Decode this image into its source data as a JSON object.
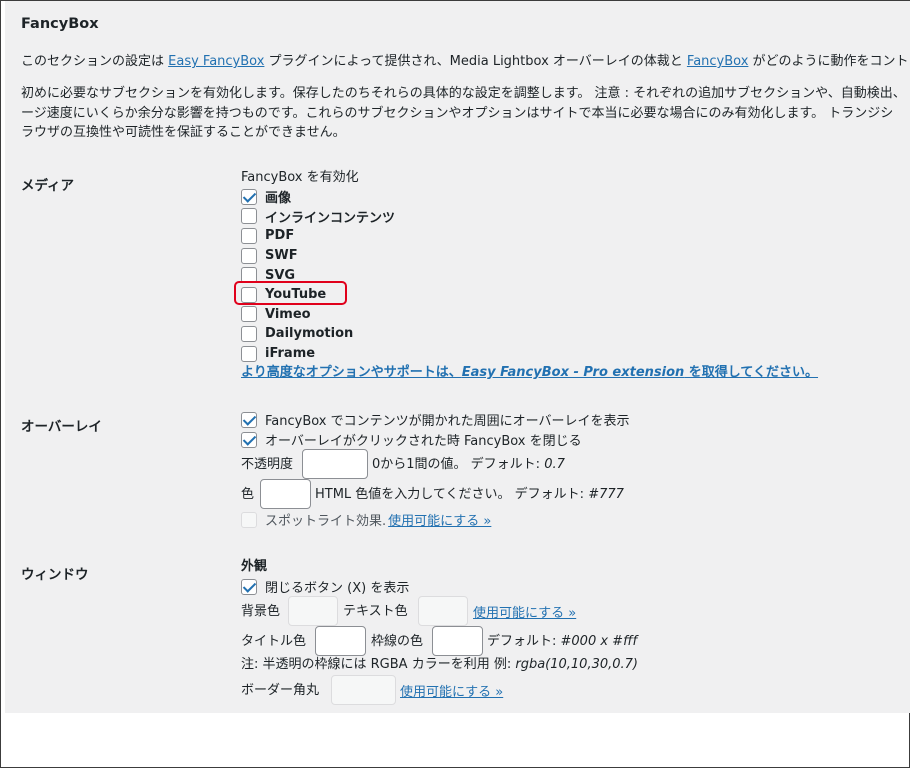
{
  "section_title": "FancyBox",
  "intro": {
    "line1": {
      "a": "このセクションの設定は ",
      "link1": "Easy FancyBox",
      "b": " プラグインによって提供され、Media Lightbox オーバーレイの体裁と ",
      "link2": "FancyBox",
      "c": " がどのように動作をコントロー"
    },
    "line2": "初めに必要なサブセクションを有効化します。保存したのちそれらの具体的な設定を調整します。 注意 : それぞれの追加サブセクションや、自動検出、",
    "line3": "ージ速度にいくらか余分な影響を持つものです。これらのサブセクションやオプションはサイトで本当に必要な場合にのみ有効化します。 トランジシ",
    "line4": "ラウザの互換性や可読性を保証することができません。"
  },
  "media": {
    "heading": "メディア",
    "enable_label": "FancyBox を有効化",
    "items": [
      {
        "label": "画像",
        "checked": true
      },
      {
        "label": "インラインコンテンツ",
        "checked": false
      },
      {
        "label": "PDF",
        "checked": false
      },
      {
        "label": "SWF",
        "checked": false
      },
      {
        "label": "SVG",
        "checked": false
      },
      {
        "label": "YouTube",
        "checked": false
      },
      {
        "label": "Vimeo",
        "checked": false
      },
      {
        "label": "Dailymotion",
        "checked": false
      },
      {
        "label": "iFrame",
        "checked": false
      }
    ],
    "pro_link": {
      "a": "より高度なオプションやサポートは、",
      "b": "Easy FancyBox - Pro extension",
      "c": " を取得してください。"
    }
  },
  "overlay": {
    "heading": "オーバーレイ",
    "show_overlay": "FancyBox でコンテンツが開かれた周囲にオーバーレイを表示",
    "close_on_click": "オーバーレイがクリックされた時 FancyBox を閉じる",
    "opacity_label": "不透明度",
    "opacity_value": "",
    "opacity_hint": "0から1間の値。 デフォルト: ",
    "opacity_default": "0.7",
    "color_label": "色",
    "color_value": "",
    "color_hint": "HTML 色値を入力してください。 デフォルト: ",
    "color_default": "#777",
    "spotlight_label": "スポットライト効果. ",
    "spotlight_link": "使用可能にする »"
  },
  "window": {
    "heading": "ウィンドウ",
    "appearance_heading": "外観",
    "show_close": "閉じるボタン (X) を表示",
    "bg_label": "背景色",
    "text_label": "テキスト色",
    "enable_link1": "使用可能にする »",
    "title_label": "タイトル色",
    "border_label": "枠線の色",
    "default_a": "デフォルト: ",
    "default_b": "#000 x #fff",
    "note_a": "注: 半透明の枠線には RGBA カラーを利用 例: ",
    "note_b": "rgba(10,10,30,0.7)",
    "radius_label": "ボーダー角丸",
    "enable_link2": "使用可能にする »"
  },
  "colors": {
    "panel_bg": "#f0f0f1",
    "link": "#2271b1",
    "highlight": "#e0001b"
  }
}
